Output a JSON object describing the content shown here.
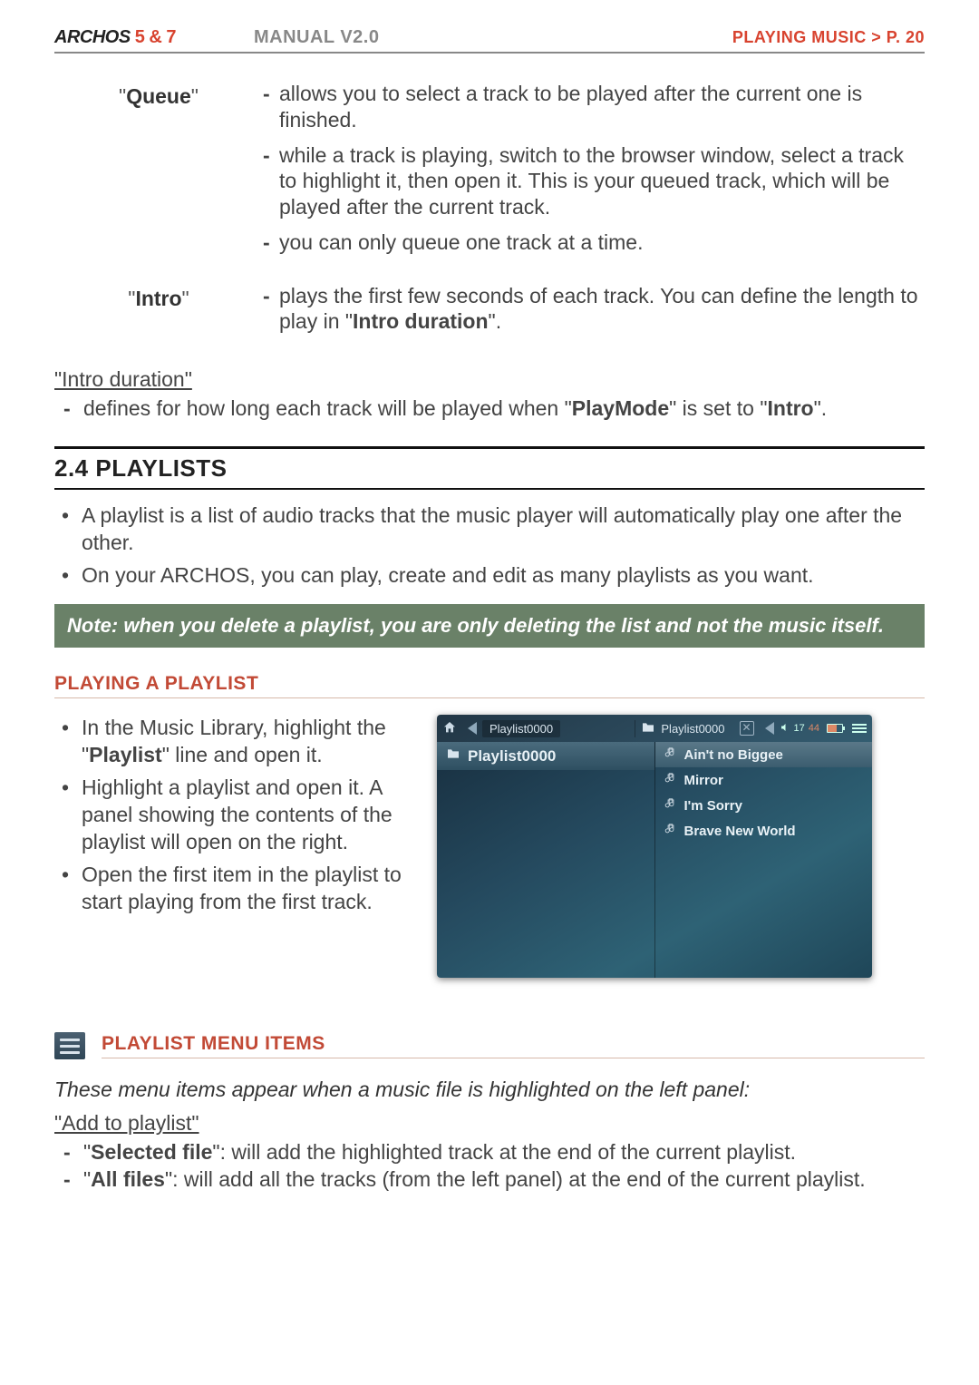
{
  "header": {
    "brand_a": "ARCHOS",
    "brand_b": "5 & 7",
    "manual": "MANUAL V2.0",
    "breadcrumb": "PLAYING MUSIC   >   P. 20"
  },
  "defs": {
    "queue": {
      "term": "Queue",
      "items": [
        "allows you to select a track to be played after the current one is finished.",
        "while a track is playing, switch to the browser window, select a track to highlight it, then open it. This is your queued track, which will be played after the current track.",
        "you can only queue one track at a time."
      ]
    },
    "intro": {
      "term": "Intro",
      "item_pre": "plays the first few seconds of each track. You can define the length to play in \"",
      "item_bold": "Intro duration",
      "item_post": "\"."
    }
  },
  "intro_duration": {
    "heading": "\"Intro duration\"",
    "line_pre": "defines for how long each track will be played when \"",
    "line_b1": "PlayMode",
    "line_mid": "\" is set to \"",
    "line_b2": "Intro",
    "line_post": "\"."
  },
  "section_24": {
    "title": "2.4 PLAYLISTS",
    "bullets": [
      "A playlist is a list of audio tracks that the music player will automatically play one after the other.",
      "On your ARCHOS, you can play, create and edit as many playlists as you want."
    ],
    "note": "Note: when you delete a playlist, you are only deleting the list and not the music itself."
  },
  "playing_playlist": {
    "heading": "PLAYING A PLAYLIST",
    "bullets_raw": [
      {
        "pre": "In the Music Library, highlight the \"",
        "b": "Playlist",
        "post": "\" line and open it."
      },
      {
        "pre": "Highlight a playlist and open it. A panel showing the contents of the playlist will open on the right.",
        "b": "",
        "post": ""
      },
      {
        "pre": "Open the first item in the playlist to start playing from the first track.",
        "b": "",
        "post": ""
      }
    ]
  },
  "playlist_menu": {
    "heading": "PLAYLIST MENU ITEMS",
    "lead": "These menu items appear when a music file is highlighted on the left panel:",
    "add_heading": "\"Add to playlist\"",
    "rows": [
      {
        "b": "Selected file",
        "txt": ": will add the highlighted track at the end of the current playlist."
      },
      {
        "b": "All files",
        "txt": ": will add all the tracks (from the left panel) at the end of the current playlist."
      }
    ]
  },
  "screenshot": {
    "crumb_left": "Playlist0000",
    "crumb_right": "Playlist0000",
    "time_h": "17",
    "time_m": "44",
    "left_header": "Playlist0000",
    "tracks": [
      "Ain't no Biggee",
      "Mirror",
      "I'm Sorry",
      "Brave New World"
    ]
  }
}
